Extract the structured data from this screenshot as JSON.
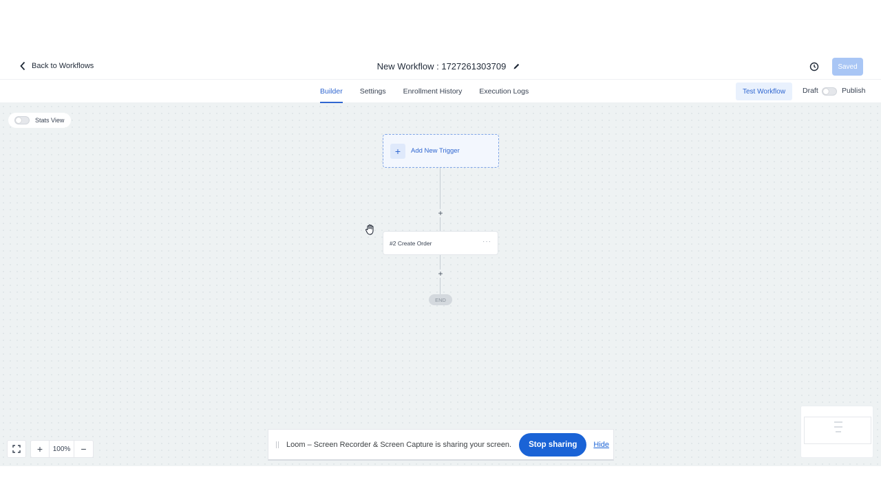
{
  "header": {
    "back_label": "Back to Workflows",
    "workflow_title": "New Workflow : 1727261303709",
    "saved_label": "Saved"
  },
  "tabs": [
    {
      "label": "Builder",
      "active": true
    },
    {
      "label": "Settings",
      "active": false
    },
    {
      "label": "Enrollment History",
      "active": false
    },
    {
      "label": "Execution Logs",
      "active": false
    }
  ],
  "actions": {
    "test_workflow_label": "Test Workflow",
    "draft_label": "Draft",
    "publish_label": "Publish"
  },
  "canvas": {
    "stats_view_label": "Stats View",
    "trigger_label": "Add New Trigger",
    "step_plus": "+",
    "action_label": "#2 Create Order",
    "action_menu": "···",
    "end_label": "END"
  },
  "zoom": {
    "fit_icon": "fullscreen-icon",
    "zoom_in": "+",
    "level": "100%",
    "zoom_out": "−"
  },
  "loom_bar": {
    "message": "Loom – Screen Recorder & Screen Capture is sharing your screen.",
    "stop_label": "Stop sharing",
    "hide_label": "Hide"
  },
  "colors": {
    "accent": "#2f66d0",
    "saved_button": "#a9c6f5",
    "canvas_bg": "#eef2f3",
    "loom_button": "#1a63d6"
  }
}
